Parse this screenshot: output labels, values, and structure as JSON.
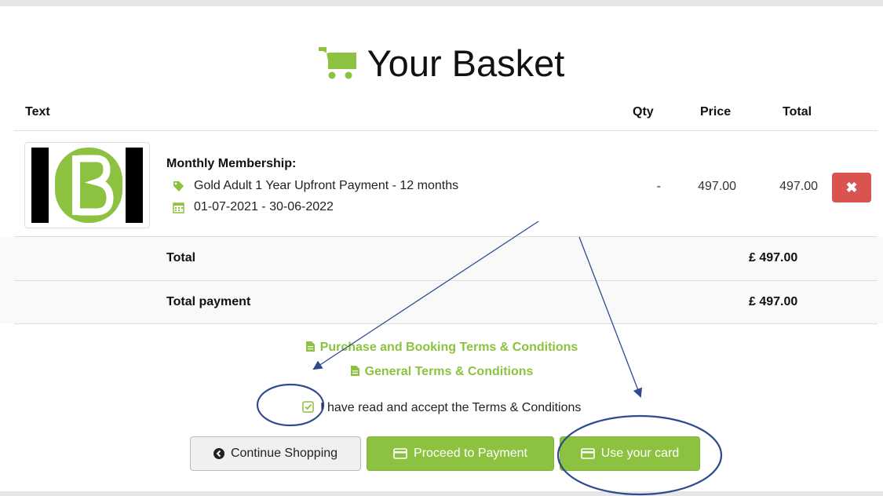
{
  "page": {
    "title": "Your Basket"
  },
  "table": {
    "headers": {
      "text": "Text",
      "qty": "Qty",
      "price": "Price",
      "total": "Total"
    },
    "item": {
      "title": "Monthly Membership:",
      "product": "Gold Adult 1 Year Upfront Payment - 12 months",
      "dates": "01-07-2021 - 30-06-2022",
      "qty": "-",
      "price": "497.00",
      "total": "497.00",
      "remove_label": "✖"
    },
    "summary": [
      {
        "label": "Total",
        "value": "£ 497.00"
      },
      {
        "label": "Total payment",
        "value": "£ 497.00"
      }
    ]
  },
  "terms": {
    "purchase_link": "Purchase and Booking Terms & Conditions",
    "general_link": "General Terms & Conditions",
    "accept_text": "I have read and accept the Terms & Conditions"
  },
  "actions": {
    "continue": "Continue Shopping",
    "proceed": "Proceed to Payment",
    "use_card": "Use your card"
  },
  "colors": {
    "brand_green": "#8cc23f",
    "danger": "#d9534f",
    "annotation": "#2f4b8f"
  },
  "icons": [
    "cart-icon",
    "tag-icon",
    "calendar-icon",
    "file-icon",
    "check-square-icon",
    "chevron-left-circle-icon",
    "credit-card-icon",
    "close-icon"
  ]
}
